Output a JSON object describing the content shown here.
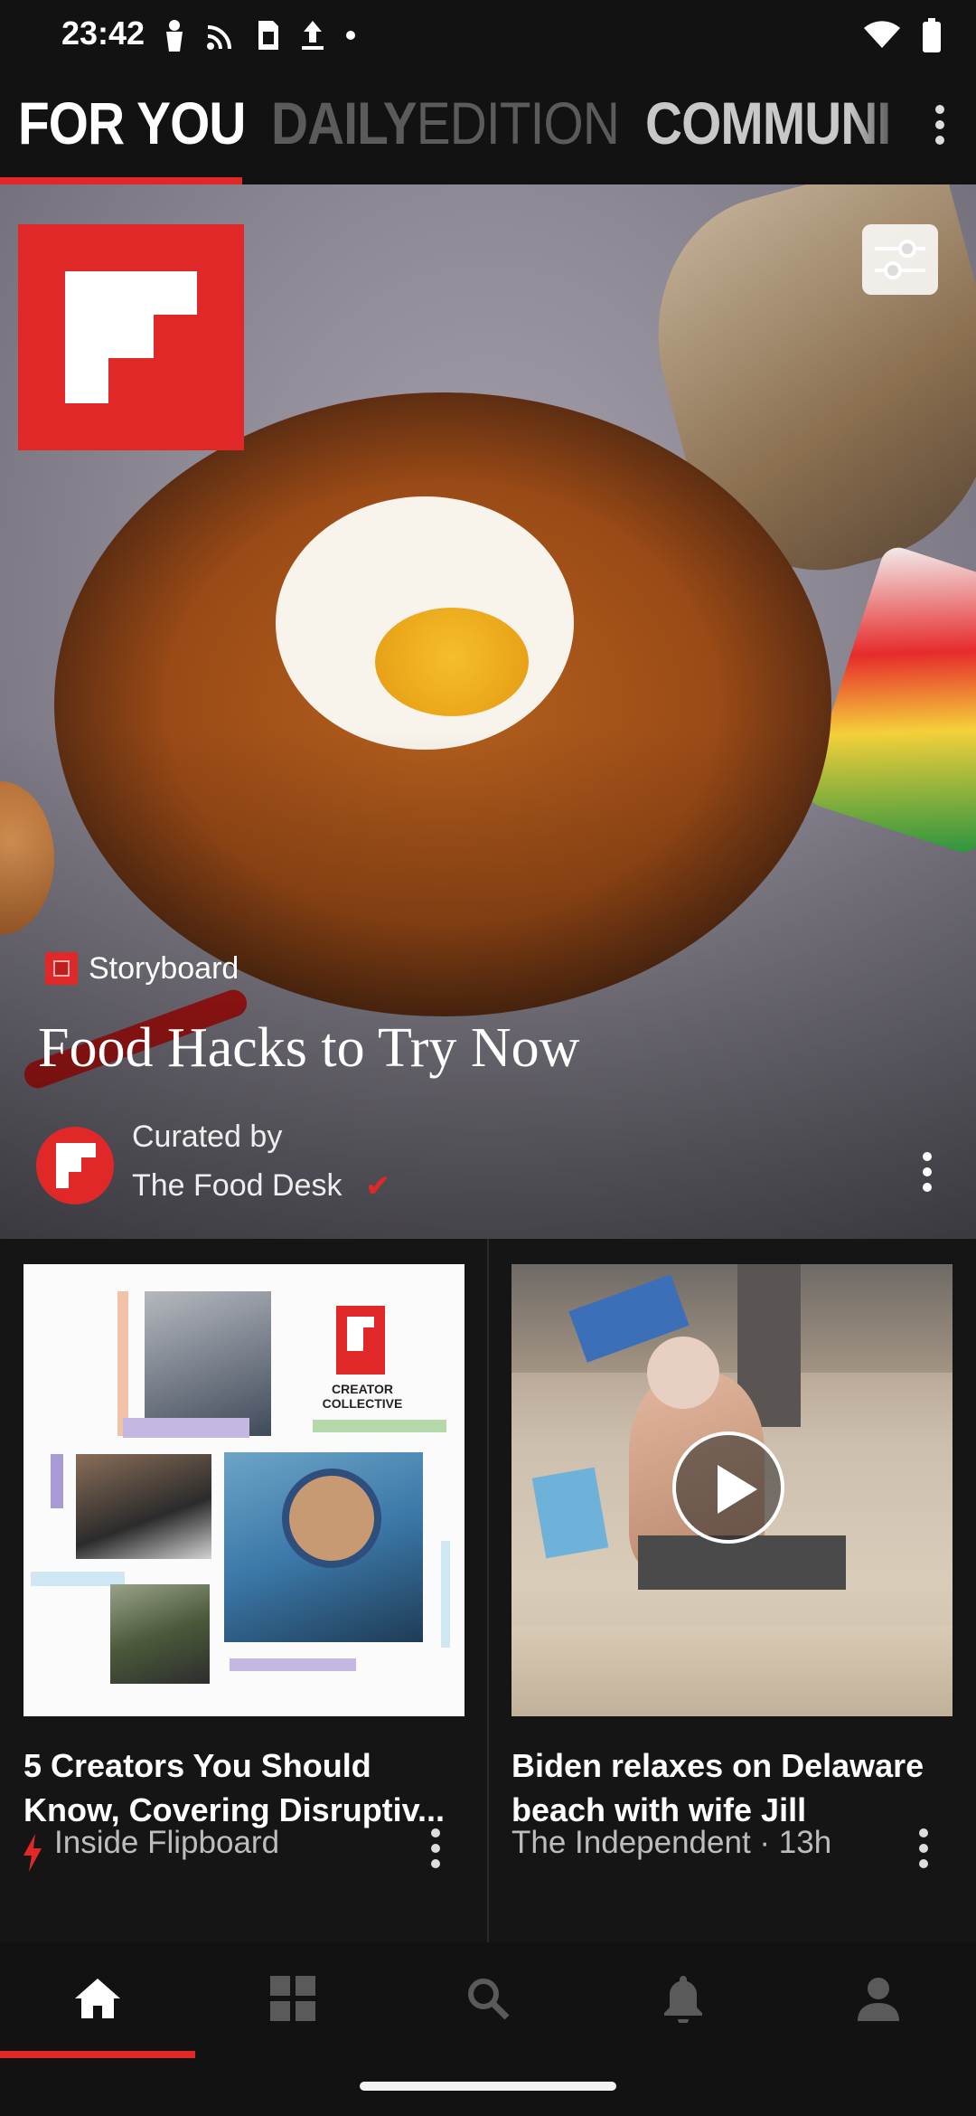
{
  "status_bar": {
    "time": "23:42"
  },
  "tabs": {
    "for_you": "FOR YOU",
    "daily_bold": "DAILY",
    "daily_light": "EDITION",
    "community": "COMMUNI"
  },
  "hero": {
    "section": "Storyboard",
    "title": "Food Hacks to Try Now",
    "curated_by": "Curated by",
    "curator": "The Food Desk",
    "verified_mark": "✔"
  },
  "collage": {
    "badge_text": "CREATOR COLLECTIVE"
  },
  "cards": [
    {
      "title": "5 Creators You Should Know, Covering Disruptiv...",
      "source": "Inside Flipboard"
    },
    {
      "title": "Biden relaxes on Delaware beach with wife Jill",
      "source": "The Independent · 13h"
    }
  ],
  "icons": {
    "status_left": [
      "person-icon",
      "cast-icon",
      "sim-icon",
      "upload-icon",
      "dot-icon"
    ],
    "status_right": [
      "wifi-icon",
      "battery-icon"
    ],
    "nav": [
      "home-icon",
      "grid-icon",
      "search-icon",
      "bell-icon",
      "profile-icon"
    ]
  },
  "colors": {
    "accent": "#e12828",
    "background": "#121212"
  }
}
